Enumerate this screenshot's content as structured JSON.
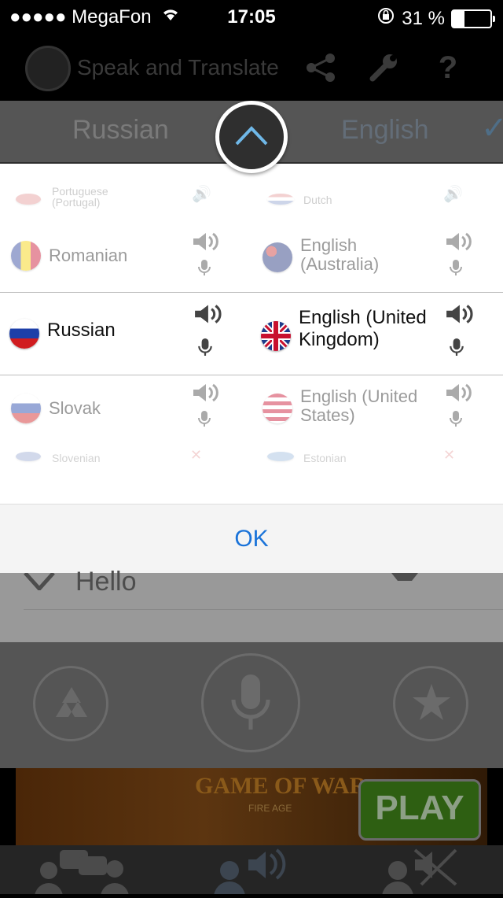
{
  "status_bar": {
    "carrier": "●●●●● MegaFon",
    "time": "17:05",
    "battery_text": "31 %",
    "battery_level": 0.31
  },
  "app": {
    "title": "Speak and Translate",
    "icons": [
      "share-icon",
      "wrench-icon",
      "help-icon"
    ]
  },
  "language_bar": {
    "source": "Russian",
    "target": "English"
  },
  "picker": {
    "left_column": [
      {
        "name": "Portuguese (Portugal)",
        "flag": "portugal"
      },
      {
        "name": "Romanian",
        "flag": "romania"
      },
      {
        "name": "Russian",
        "flag": "russia",
        "selected": true
      },
      {
        "name": "Slovak",
        "flag": "slovakia"
      },
      {
        "name": "Slovenian",
        "flag": "slovenia"
      }
    ],
    "right_column": [
      {
        "name": "Dutch",
        "flag": "netherlands"
      },
      {
        "name": "English (Australia)",
        "flag": "australia"
      },
      {
        "name": "English (United Kingdom)",
        "flag": "uk",
        "selected": true
      },
      {
        "name": "English (United States)",
        "flag": "usa"
      },
      {
        "name": "Estonian",
        "flag": "estonia"
      }
    ]
  },
  "ok_label": "OK",
  "background_word": "Hello",
  "ad": {
    "title": "GAME OF WAR",
    "subtitle": "FIRE AGE",
    "button": "PLAY"
  },
  "tabs": [
    "conversation-tab",
    "speak-tab",
    "mute-tab"
  ],
  "colors": {
    "accent": "#1a73d9",
    "toggle_arrow": "#6fb8e8"
  }
}
